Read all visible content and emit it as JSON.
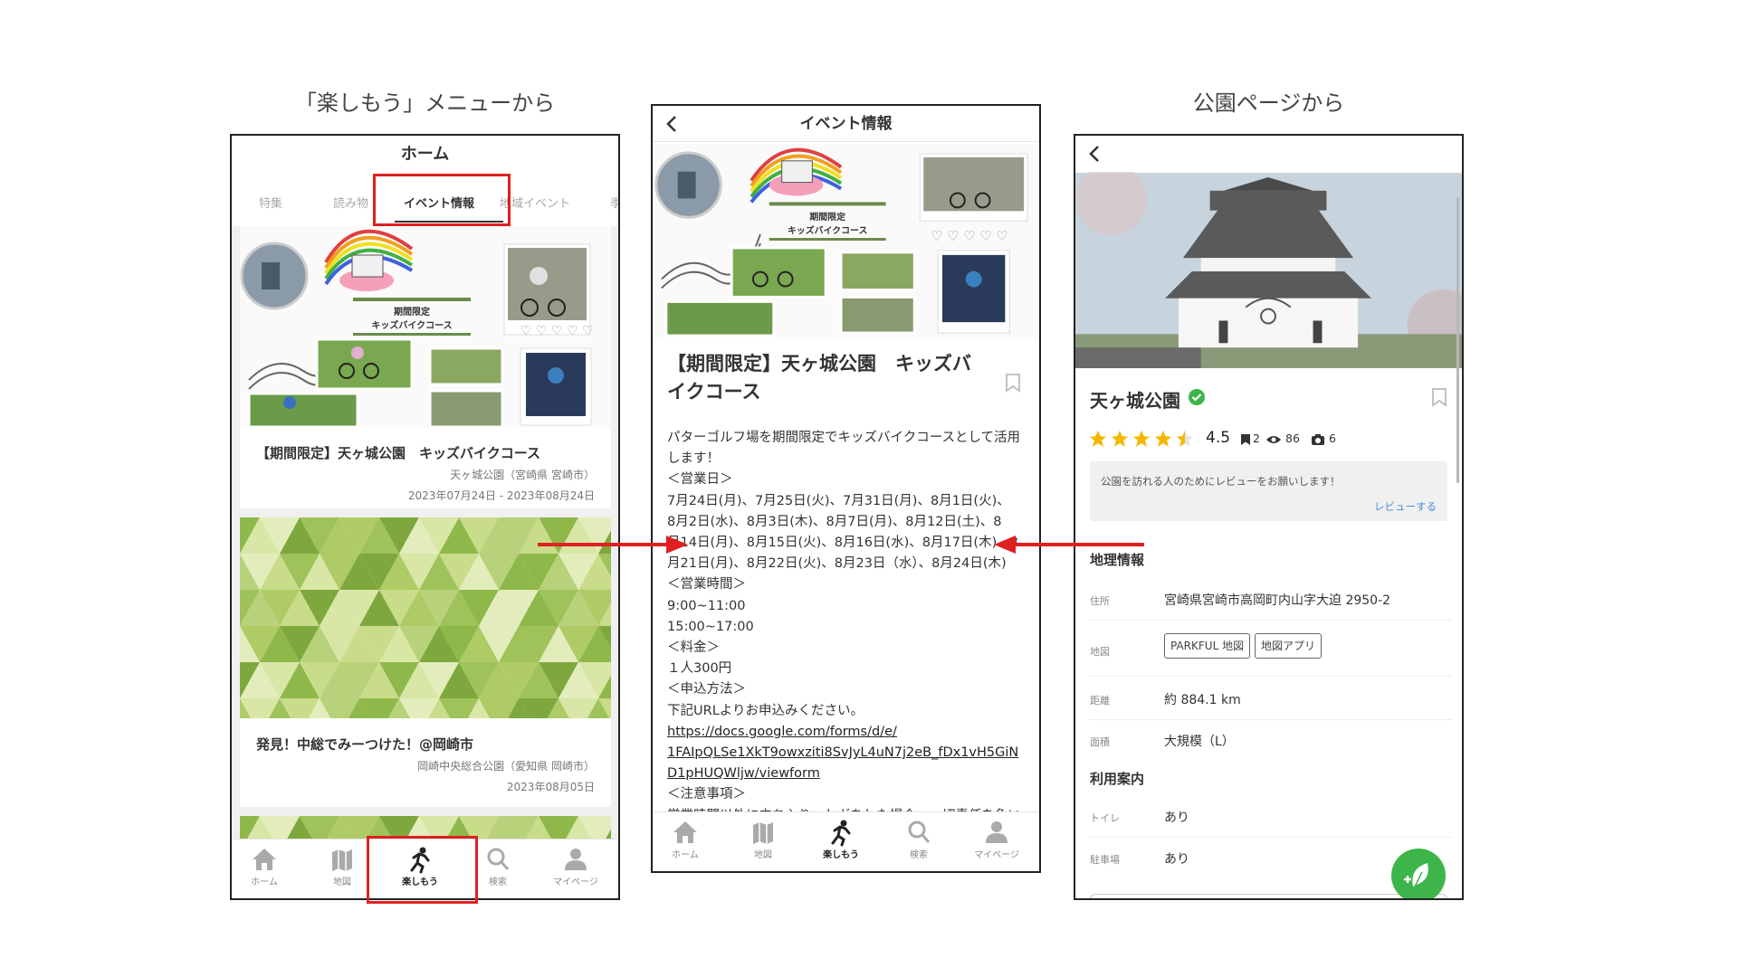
{
  "captions": {
    "left": "「楽しもう」メニューから",
    "right": "公園ページから"
  },
  "phone1": {
    "header_title": "ホーム",
    "tabs": [
      "特集",
      "読み物",
      "イベント情報",
      "地域イベント",
      "季"
    ],
    "active_tab": "イベント情報",
    "cards": [
      {
        "title": "【期間限定】天ヶ城公園　キッズバイクコース",
        "location": "天ヶ城公園（宮崎県 宮崎市）",
        "date": "2023年07月24日 - 2023年08月24日",
        "image_caption": "期間限定\nキッズバイクコース"
      },
      {
        "title": "発見！中総でみーつけた！@岡崎市",
        "location": "岡崎中央総合公園（愛知県 岡崎市）",
        "date": "2023年08月05日"
      }
    ]
  },
  "bottom_nav": [
    {
      "label": "ホーム",
      "icon": "home-icon"
    },
    {
      "label": "地図",
      "icon": "map-icon"
    },
    {
      "label": "楽しもう",
      "icon": "running-person-icon"
    },
    {
      "label": "検索",
      "icon": "search-icon"
    },
    {
      "label": "マイページ",
      "icon": "person-icon"
    }
  ],
  "phone2": {
    "header_title": "イベント情報",
    "title": "【期間限定】天ヶ城公園　キッズバイクコース",
    "image_caption": "期間限定\nキッズバイクコース",
    "body_lines": [
      "パターゴルフ場を期間限定でキッズバイクコースとして活用",
      "します！",
      "＜営業日＞",
      "7月24日(月)、7月25日(火)、7月31日(月)、8月1日(火)、",
      "8月2日(水)、8月3日(木)、8月7日(月)、8月12日(土)、8",
      "月14日(月)、8月15日(火)、8月16日(水)、8月17日(木)、8",
      "月21日(月)、8月22日(火)、8月23日（水）、8月24日(木)",
      "＜営業時間＞",
      "9:00~11:00",
      "15:00~17:00",
      "＜料金＞",
      "１人300円",
      "＜申込方法＞",
      "下記URLよりお申込みください。"
    ],
    "link_lines": [
      "https://docs.google.com/forms/d/e/",
      "1FAIpQLSe1XkT9owxziti8SvJyL4uN7j2eB_fDx1vH5GiN",
      "D1pHUQWljw/viewform"
    ],
    "tail_lines": [
      "＜注意事項＞",
      "営業時間以外に立ち入り、ケガをした場合、一切責任を負い"
    ]
  },
  "phone3": {
    "park_name": "天ヶ城公園",
    "rating": "4.5",
    "rating_value": 4.5,
    "bookmarks": "2",
    "views": "86",
    "photos": "6",
    "review_prompt": "公園を訪れる人のためにレビューをお願いします！",
    "review_action": "レビューする",
    "geo_section": "地理情報",
    "address_label": "住所",
    "address": "宮崎県宮崎市高岡町内山字大迫 2950-2",
    "map_label": "地図",
    "map_buttons": [
      "PARKFUL 地図",
      "地図アプリ"
    ],
    "distance_label": "距離",
    "distance": "約 884.1 km",
    "area_label": "面積",
    "area": "大規模（L）",
    "usage_section": "利用案内",
    "toilet_label": "トイレ",
    "toilet": "あり",
    "parking_label": "駐車場",
    "parking": "あり"
  },
  "colors": {
    "highlight": "#e02020",
    "accent_green": "#3db54a",
    "star": "#f5b800",
    "link_blue": "#4a90d9"
  }
}
